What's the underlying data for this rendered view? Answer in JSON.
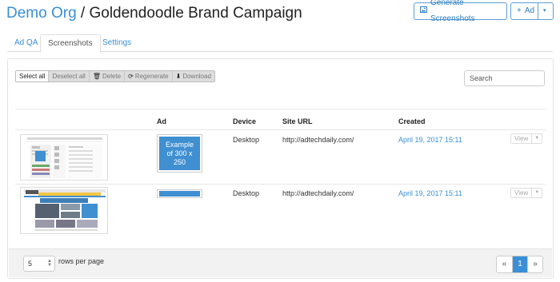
{
  "header": {
    "org": "Demo Org",
    "separator": " / ",
    "campaign": "Goldendoodle Brand Campaign",
    "generate_label": "Generate Screenshots",
    "add_label": "Ad",
    "add_dropdown_icon": "caret-down-icon"
  },
  "tabs": [
    {
      "label": "Ad QA",
      "active": false
    },
    {
      "label": "Screenshots",
      "active": true
    },
    {
      "label": "Settings",
      "active": false
    }
  ],
  "toolbar": {
    "select_all": "Select all",
    "deselect_all": "Deselect all",
    "delete": "Delete",
    "regenerate": "Regenerate",
    "download": "Download"
  },
  "search": {
    "placeholder": "Search"
  },
  "table": {
    "columns": [
      "Ad",
      "Device",
      "Site URL",
      "Created"
    ],
    "rows": [
      {
        "ad_text": "Example of 300 x 250",
        "device": "Desktop",
        "site_url": "http://adtechdaily.com/",
        "created": "April 19, 2017 15:11",
        "view_label": "View"
      },
      {
        "ad_text": "",
        "device": "Desktop",
        "site_url": "http://adtechdaily.com/",
        "created": "April 19, 2017 15:11",
        "view_label": "View"
      }
    ]
  },
  "footer": {
    "page_size": "5",
    "rows_per_page_label": "rows per page",
    "pager": {
      "prev": "«",
      "current": "1",
      "next": "»"
    }
  },
  "colors": {
    "link": "#3a8fd6",
    "ad_blue": "#3f8fd1"
  }
}
